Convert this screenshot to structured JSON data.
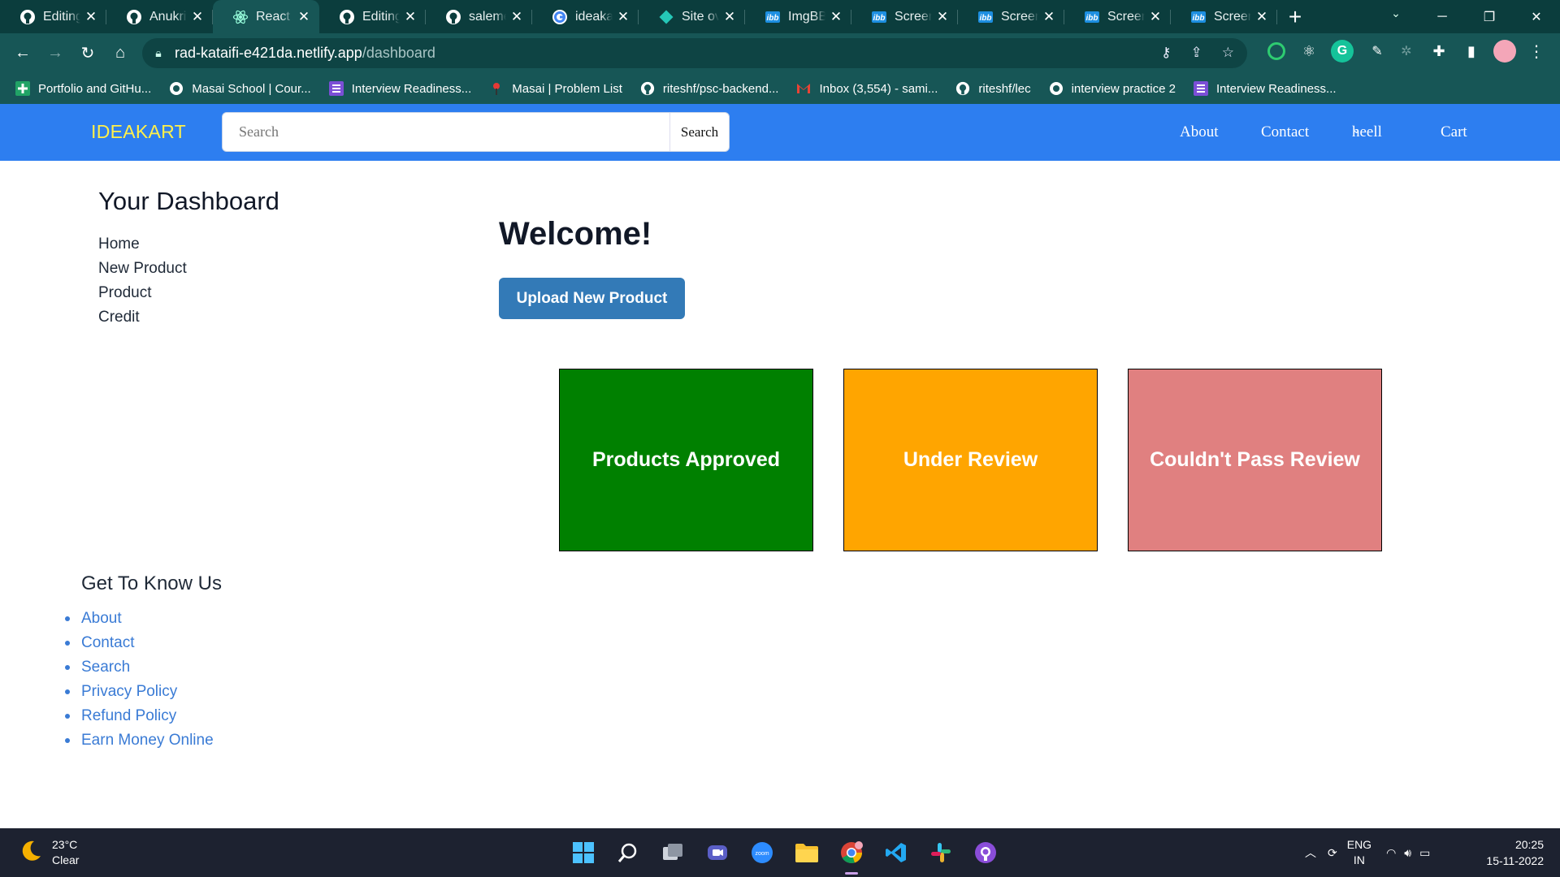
{
  "browser": {
    "tabs": [
      {
        "title": "Editing",
        "icon": "github-icon",
        "active": false
      },
      {
        "title": "Anukriti",
        "icon": "github-icon",
        "active": false
      },
      {
        "title": "React App",
        "icon": "react-icon",
        "active": true
      },
      {
        "title": "Editing",
        "icon": "github-icon",
        "active": false
      },
      {
        "title": "salemeb",
        "icon": "github-icon",
        "active": false
      },
      {
        "title": "ideakart",
        "icon": "google-icon",
        "active": false
      },
      {
        "title": "Site ove",
        "icon": "netlify-icon",
        "active": false
      },
      {
        "title": "ImgBB",
        "icon": "imgbb-icon",
        "active": false
      },
      {
        "title": "Screens",
        "icon": "imgbb-icon",
        "active": false
      },
      {
        "title": "Screens",
        "icon": "imgbb-icon",
        "active": false
      },
      {
        "title": "Screens",
        "icon": "imgbb-icon",
        "active": false
      },
      {
        "title": "Screens",
        "icon": "imgbb-icon",
        "active": false
      }
    ],
    "url_host": "rad-kataifi-e421da.netlify.app",
    "url_path": "/dashboard",
    "bookmarks": [
      {
        "label": "Portfolio and GitHu...",
        "icon": "green-plus-icon"
      },
      {
        "label": "Masai School | Cour...",
        "icon": "globe-icon"
      },
      {
        "label": "Interview Readiness...",
        "icon": "list-icon"
      },
      {
        "label": "Masai | Problem List",
        "icon": "masai-icon"
      },
      {
        "label": "riteshf/psc-backend...",
        "icon": "github-icon"
      },
      {
        "label": "Inbox (3,554) - sami...",
        "icon": "gmail-icon"
      },
      {
        "label": "riteshf/lec",
        "icon": "github-icon"
      },
      {
        "label": "interview practice 2",
        "icon": "globe-icon"
      },
      {
        "label": "Interview Readiness...",
        "icon": "list-icon"
      }
    ]
  },
  "navbar": {
    "brand": "IDEAKART",
    "search_placeholder": "Search",
    "search_button": "Search",
    "links": {
      "about": "About",
      "contact": "Contact",
      "user": "heell",
      "cart": "Cart"
    }
  },
  "dashboard": {
    "title": "Your Dashboard",
    "menu": [
      "Home",
      "New Product",
      "Product",
      "Credit"
    ],
    "welcome": "Welcome!",
    "upload_button": "Upload New Product",
    "cards": [
      {
        "label": "Products Approved",
        "color": "#008000"
      },
      {
        "label": "Under Review",
        "color": "#FFA500"
      },
      {
        "label": "Couldn't Pass Review",
        "color": "#E08080"
      }
    ]
  },
  "footer": {
    "title": "Get To Know Us",
    "links": [
      "About",
      "Contact",
      "Search",
      "Privacy Policy",
      "Refund Policy",
      "Earn Money Online"
    ]
  },
  "taskbar": {
    "temperature": "23°C",
    "weather": "Clear",
    "lang_top": "ENG",
    "lang_bottom": "IN",
    "time": "20:25",
    "date": "15-11-2022"
  },
  "colors": {
    "navbar": "#2D7EF0",
    "brand": "#FFF04A",
    "upload_button": "#337AB7",
    "footer_link": "#3A7BD5",
    "browser_frame": "#175656"
  }
}
